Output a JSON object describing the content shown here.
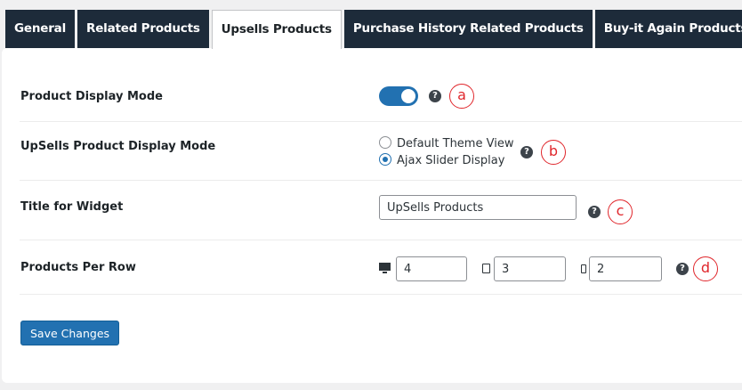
{
  "tabs": [
    {
      "label": "General",
      "active": false
    },
    {
      "label": "Related Products",
      "active": false
    },
    {
      "label": "Upsells Products",
      "active": true
    },
    {
      "label": "Purchase History Related Products",
      "active": false
    },
    {
      "label": "Buy-it Again Products",
      "active": false
    }
  ],
  "settings": {
    "display_mode": {
      "label": "Product Display Mode",
      "enabled": true,
      "help": "?",
      "annotation": "a"
    },
    "upsells_display_mode": {
      "label": "UpSells Product Display Mode",
      "options": [
        "Default Theme View",
        "Ajax Slider Display"
      ],
      "selected": "Ajax Slider Display",
      "help": "?",
      "annotation": "b"
    },
    "widget_title": {
      "label": "Title for Widget",
      "value": "UpSells Products",
      "help": "?",
      "annotation": "c"
    },
    "products_per_row": {
      "label": "Products Per Row",
      "desktop": "4",
      "tablet": "3",
      "mobile": "2",
      "help": "?",
      "annotation": "d"
    }
  },
  "save_button_label": "Save Changes",
  "colors": {
    "tab_bg": "#1d2b3a",
    "accent": "#2271b1",
    "annotation": "#e0262b"
  }
}
